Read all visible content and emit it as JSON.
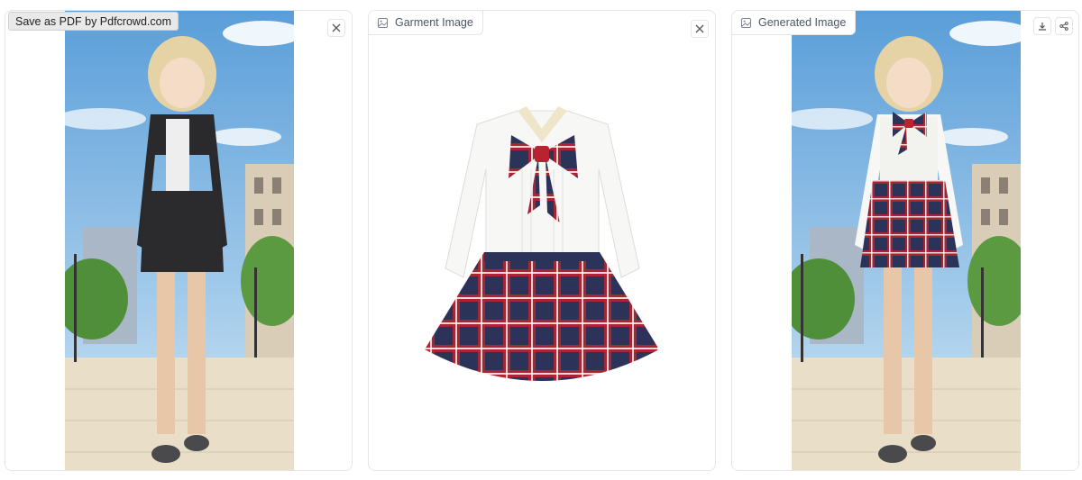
{
  "overlay": {
    "pdf_label": "Save as PDF by Pdfcrowd.com"
  },
  "panels": {
    "person": {
      "label": "",
      "close_icon": "close-icon"
    },
    "garment": {
      "label": "Garment Image",
      "tab_icon": "image-icon",
      "close_icon": "close-icon"
    },
    "generated": {
      "label": "Generated Image",
      "tab_icon": "image-icon",
      "download_icon": "download-icon",
      "share_icon": "share-icon"
    }
  },
  "colors": {
    "panel_border": "#e3e5e8",
    "sky": "#79b4e3",
    "pavement": "#e9dfc9",
    "plaid_navy": "#2c3358",
    "plaid_red": "#b8232f"
  }
}
